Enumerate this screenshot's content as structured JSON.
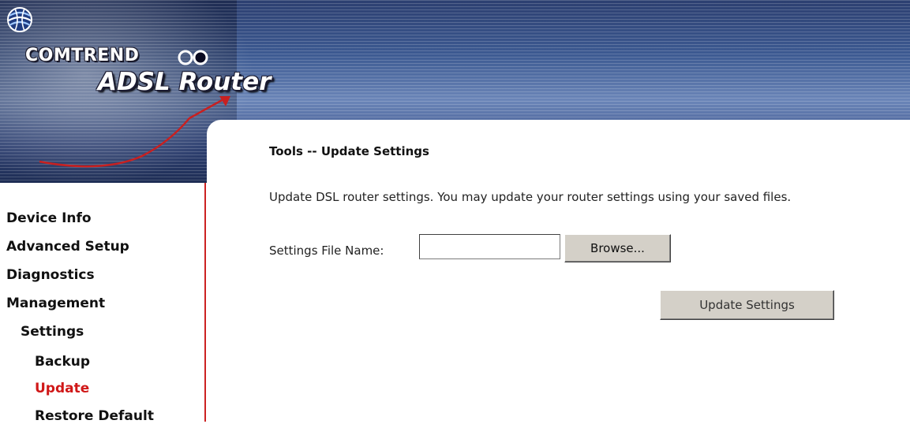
{
  "header": {
    "brand": "COMTREND",
    "product": "ADSL Router"
  },
  "nav": {
    "items": [
      {
        "label": "Device Info",
        "active": false
      },
      {
        "label": "Advanced Setup",
        "active": false
      },
      {
        "label": "Diagnostics",
        "active": false
      },
      {
        "label": "Management",
        "active": false
      },
      {
        "label": "Settings",
        "active": false
      },
      {
        "label": "Backup",
        "active": false
      },
      {
        "label": "Update",
        "active": true
      },
      {
        "label": "Restore Default",
        "active": false
      }
    ]
  },
  "main": {
    "title": "Tools -- Update Settings",
    "description": "Update DSL router settings. You may update your router settings using your saved files.",
    "file_label": "Settings File Name:",
    "file_value": "",
    "browse_label": "Browse...",
    "update_label": "Update Settings"
  },
  "colors": {
    "active_nav": "#d01818",
    "nav_border": "#cc2222",
    "button_face": "#d4d0c8"
  },
  "icons": {
    "logo": "comtrend-globe-icon",
    "arrow": "rising-arrow-graphic"
  }
}
